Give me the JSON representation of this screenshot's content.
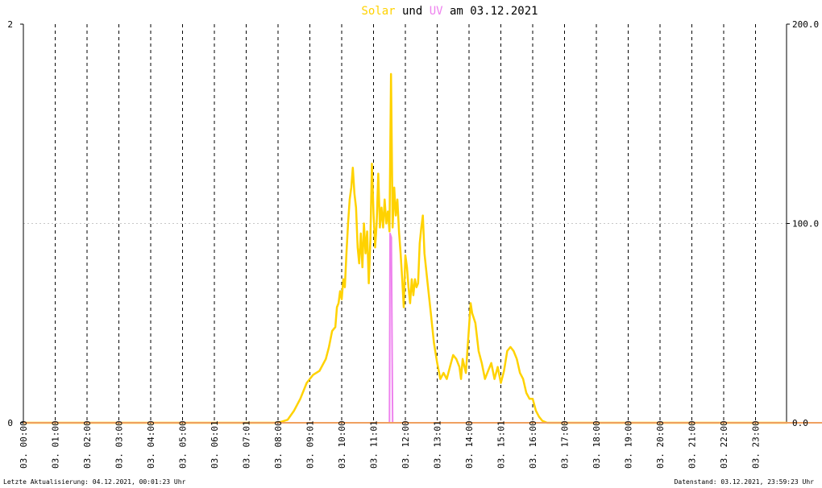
{
  "title": {
    "part1": "Solar",
    "part2": " und ",
    "part3": "UV",
    "part4": " am 03.12.2021"
  },
  "footer": {
    "left": "Letzte Aktualisierung: 04.12.2021, 00:01:23 Uhr",
    "right": "Datenstand: 03.12.2021, 23:59:23 Uhr"
  },
  "colors": {
    "solar": "#ffd200",
    "uv": "#ee82ee",
    "baseline": "#f0a060",
    "title_solar": "#ffd200",
    "title_uv": "#ee82ee",
    "grid": "#000000",
    "hgrid": "#c8c8c8"
  },
  "chart_data": {
    "type": "line",
    "x_tick_labels": [
      "03. 00:00",
      "03. 01:00",
      "03. 02:00",
      "03. 03:00",
      "03. 04:00",
      "03. 05:00",
      "03. 06:01",
      "03. 07:01",
      "03. 08:00",
      "03. 09:01",
      "03. 10:00",
      "03. 11:01",
      "03. 12:00",
      "03. 13:01",
      "03. 14:00",
      "03. 15:01",
      "03. 16:00",
      "03. 17:00",
      "03. 18:00",
      "03. 19:00",
      "03. 20:00",
      "03. 21:00",
      "03. 22:00",
      "03. 23:00"
    ],
    "x_range_hours": [
      0,
      24
    ],
    "y_left": {
      "ticks": [
        "0",
        "2"
      ],
      "range": [
        0,
        2
      ]
    },
    "y_right": {
      "ticks": [
        "0.0",
        "100.0",
        "200.0"
      ],
      "range": [
        0,
        200
      ]
    },
    "grid": true,
    "series": [
      {
        "name": "Solar",
        "axis": "right",
        "points": [
          [
            0,
            0
          ],
          [
            7.9,
            0
          ],
          [
            8.1,
            0.5
          ],
          [
            8.3,
            1.5
          ],
          [
            8.5,
            6
          ],
          [
            8.7,
            12
          ],
          [
            8.9,
            20
          ],
          [
            9.1,
            24
          ],
          [
            9.3,
            26
          ],
          [
            9.5,
            32
          ],
          [
            9.6,
            38
          ],
          [
            9.7,
            46
          ],
          [
            9.8,
            48
          ],
          [
            9.85,
            58
          ],
          [
            9.9,
            60
          ],
          [
            9.95,
            66
          ],
          [
            10.0,
            62
          ],
          [
            10.05,
            72
          ],
          [
            10.1,
            68
          ],
          [
            10.15,
            85
          ],
          [
            10.2,
            100
          ],
          [
            10.25,
            112
          ],
          [
            10.3,
            118
          ],
          [
            10.35,
            128
          ],
          [
            10.4,
            115
          ],
          [
            10.45,
            108
          ],
          [
            10.5,
            88
          ],
          [
            10.55,
            80
          ],
          [
            10.6,
            95
          ],
          [
            10.65,
            78
          ],
          [
            10.7,
            100
          ],
          [
            10.75,
            85
          ],
          [
            10.8,
            96
          ],
          [
            10.85,
            70
          ],
          [
            10.9,
            92
          ],
          [
            10.95,
            130
          ],
          [
            11.0,
            105
          ],
          [
            11.05,
            88
          ],
          [
            11.1,
            100
          ],
          [
            11.15,
            125
          ],
          [
            11.2,
            98
          ],
          [
            11.25,
            108
          ],
          [
            11.3,
            98
          ],
          [
            11.35,
            112
          ],
          [
            11.4,
            100
          ],
          [
            11.45,
            106
          ],
          [
            11.5,
            96
          ],
          [
            11.55,
            175
          ],
          [
            11.6,
            98
          ],
          [
            11.65,
            118
          ],
          [
            11.7,
            104
          ],
          [
            11.75,
            112
          ],
          [
            11.8,
            96
          ],
          [
            11.85,
            85
          ],
          [
            11.9,
            72
          ],
          [
            11.95,
            58
          ],
          [
            12.0,
            84
          ],
          [
            12.05,
            78
          ],
          [
            12.1,
            68
          ],
          [
            12.15,
            60
          ],
          [
            12.2,
            72
          ],
          [
            12.25,
            64
          ],
          [
            12.3,
            72
          ],
          [
            12.35,
            68
          ],
          [
            12.4,
            70
          ],
          [
            12.45,
            90
          ],
          [
            12.5,
            98
          ],
          [
            12.55,
            104
          ],
          [
            12.6,
            85
          ],
          [
            12.7,
            70
          ],
          [
            12.8,
            55
          ],
          [
            12.9,
            40
          ],
          [
            13.0,
            30
          ],
          [
            13.1,
            22
          ],
          [
            13.2,
            25
          ],
          [
            13.3,
            22
          ],
          [
            13.4,
            28
          ],
          [
            13.5,
            34
          ],
          [
            13.6,
            32
          ],
          [
            13.7,
            28
          ],
          [
            13.75,
            22
          ],
          [
            13.8,
            32
          ],
          [
            13.9,
            25
          ],
          [
            14.0,
            48
          ],
          [
            14.05,
            60
          ],
          [
            14.1,
            55
          ],
          [
            14.2,
            50
          ],
          [
            14.3,
            36
          ],
          [
            14.4,
            30
          ],
          [
            14.5,
            22
          ],
          [
            14.6,
            26
          ],
          [
            14.7,
            30
          ],
          [
            14.8,
            22
          ],
          [
            14.9,
            28
          ],
          [
            15.0,
            20
          ],
          [
            15.1,
            26
          ],
          [
            15.2,
            36
          ],
          [
            15.3,
            38
          ],
          [
            15.4,
            36
          ],
          [
            15.5,
            32
          ],
          [
            15.6,
            25
          ],
          [
            15.7,
            22
          ],
          [
            15.8,
            15
          ],
          [
            15.9,
            12
          ],
          [
            16.0,
            12
          ],
          [
            16.1,
            6
          ],
          [
            16.2,
            3
          ],
          [
            16.3,
            1
          ],
          [
            16.45,
            0
          ],
          [
            24,
            0
          ]
        ]
      },
      {
        "name": "UV",
        "axis": "left",
        "points": [
          [
            0,
            0
          ],
          [
            11.5,
            0
          ],
          [
            11.52,
            0.95
          ],
          [
            11.56,
            0.93
          ],
          [
            11.6,
            0
          ],
          [
            24,
            0
          ]
        ]
      }
    ]
  }
}
